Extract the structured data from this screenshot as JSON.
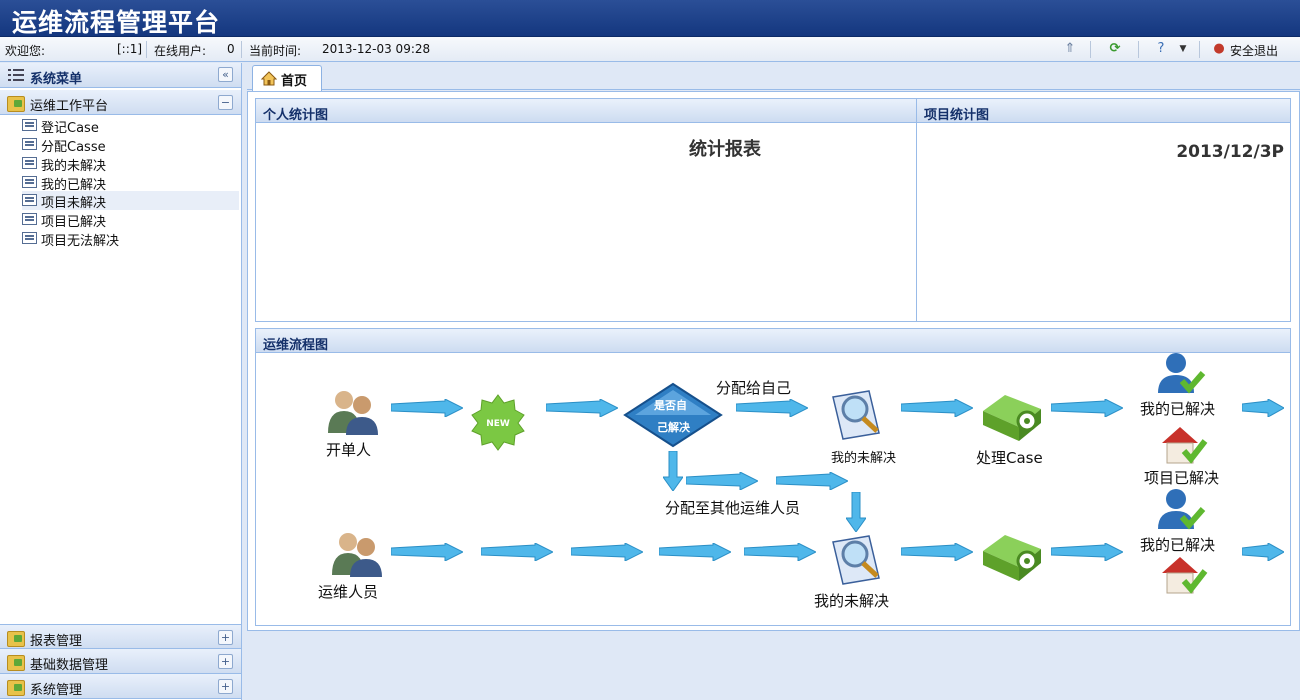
{
  "header": {
    "title": "运维流程管理平台"
  },
  "statusbar": {
    "welcome_label": "欢迎您:",
    "user_ip": "[::1]",
    "online_label": "在线用户:",
    "online_count": "0",
    "time_label": "当前时间:",
    "time_value": "2013-12-03 09:28",
    "logout_label": "安全退出"
  },
  "sidebar": {
    "title": "系统菜单",
    "groups": [
      {
        "label": "运维工作平台",
        "expanded": true
      },
      {
        "label": "报表管理",
        "expanded": false
      },
      {
        "label": "基础数据管理",
        "expanded": false
      },
      {
        "label": "系统管理",
        "expanded": false
      }
    ],
    "items": [
      {
        "label": "登记Case"
      },
      {
        "label": "分配Casse"
      },
      {
        "label": "我的未解决"
      },
      {
        "label": "我的已解决"
      },
      {
        "label": "项目未解决"
      },
      {
        "label": "项目已解决"
      },
      {
        "label": "项目无法解决"
      }
    ]
  },
  "tabs": [
    {
      "label": "首页",
      "active": true
    }
  ],
  "panels": {
    "personal": {
      "title": "个人统计图",
      "chart_title": "统计报表"
    },
    "project": {
      "title": "项目统计图",
      "chart_title": "2013/12/3P"
    },
    "flow": {
      "title": "运维流程图"
    }
  },
  "flow": {
    "opener": "开单人",
    "new_badge": "NEW",
    "decision_line1": "是否自",
    "decision_line2": "己解决",
    "assign_self": "分配给自己",
    "my_unresolved_small": "我的未解决",
    "handle_case": "处理Case",
    "my_resolved_1": "我的已解决",
    "project_resolved": "项目已解决",
    "assign_other": "分配至其他运维人员",
    "ops_staff": "运维人员",
    "my_unresolved_2": "我的未解决",
    "my_resolved_2": "我的已解决"
  },
  "colors": {
    "header": "#1a3c86",
    "panel_border": "#99bbe8",
    "arrow": "#4fb7ea"
  }
}
